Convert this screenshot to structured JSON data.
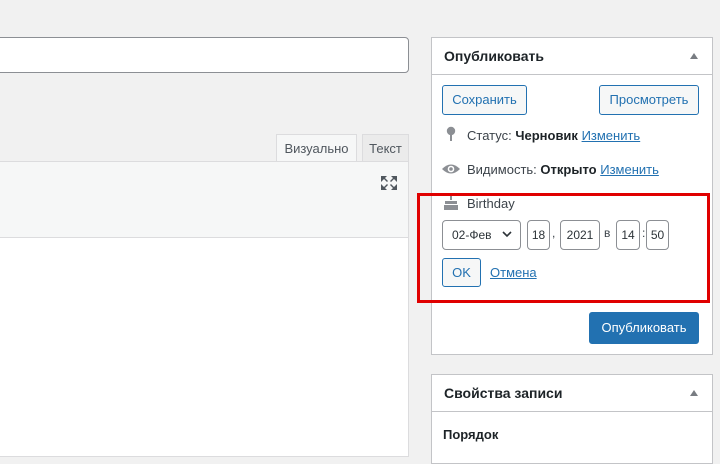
{
  "editor": {
    "tabs": [
      {
        "label": "Визуально"
      },
      {
        "label": "Текст"
      }
    ]
  },
  "publish": {
    "title": "Опубликовать",
    "save_label": "Сохранить",
    "preview_label": "Просмотреть",
    "status": {
      "label": "Статус:",
      "value": "Черновик",
      "link": "Изменить"
    },
    "visibility": {
      "label": "Видимость:",
      "value": "Открыто",
      "link": "Изменить"
    },
    "date_label": "Birthday",
    "month": "02-Фев",
    "day": "18",
    "year": "2021",
    "at": "в",
    "hour": "14",
    "minute": "50",
    "ok_label": "OK",
    "cancel_label": "Отмена",
    "publish_label": "Опубликовать",
    "primary_color": "#2271b1",
    "highlight_color": "#e00000"
  },
  "post_props": {
    "title": "Свойства записи",
    "order_label": "Порядок"
  }
}
